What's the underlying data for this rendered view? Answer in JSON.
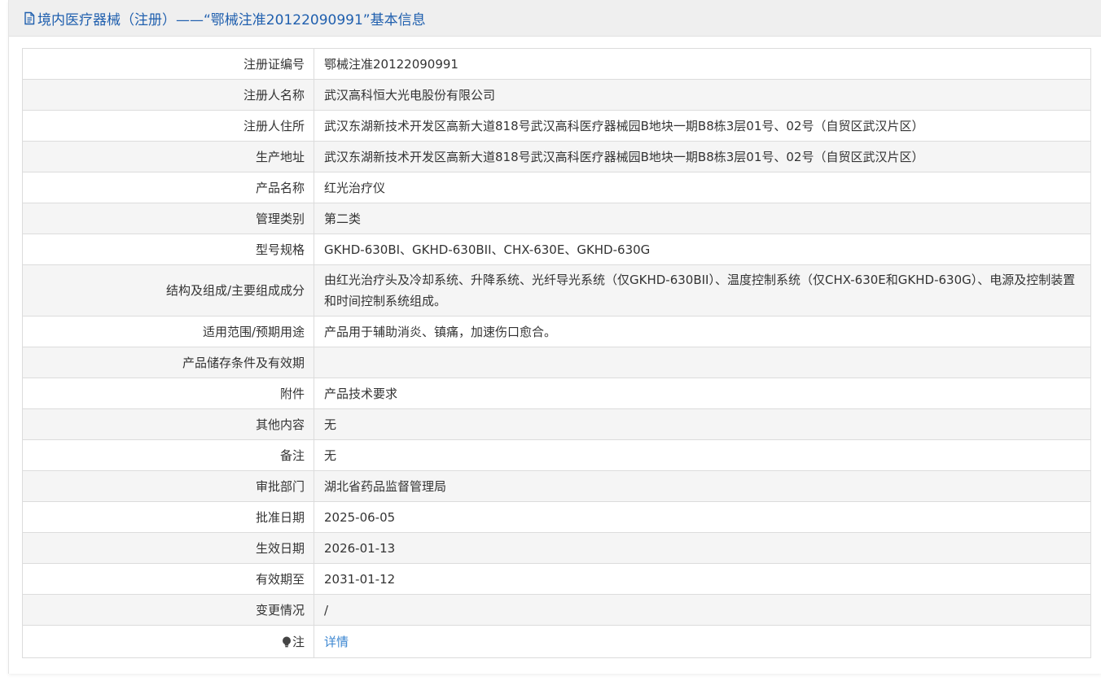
{
  "header": {
    "title": "境内医疗器械（注册）——“鄂械注准20122090991”基本信息"
  },
  "rows": [
    {
      "label": "注册证编号",
      "value": "鄂械注准20122090991"
    },
    {
      "label": "注册人名称",
      "value": "武汉高科恒大光电股份有限公司"
    },
    {
      "label": "注册人住所",
      "value": "武汉东湖新技术开发区高新大道818号武汉高科医疗器械园B地块一期B8栋3层01号、02号（自贸区武汉片区）"
    },
    {
      "label": "生产地址",
      "value": "武汉东湖新技术开发区高新大道818号武汉高科医疗器械园B地块一期B8栋3层01号、02号（自贸区武汉片区）"
    },
    {
      "label": "产品名称",
      "value": "红光治疗仪"
    },
    {
      "label": "管理类别",
      "value": "第二类"
    },
    {
      "label": "型号规格",
      "value": "GKHD-630BI、GKHD-630BII、CHX-630E、GKHD-630G"
    },
    {
      "label": "结构及组成/主要组成成分",
      "value": "由红光治疗头及冷却系统、升降系统、光纤导光系统（仅GKHD-630BII）、温度控制系统（仅CHX-630E和GKHD-630G）、电源及控制装置和时间控制系统组成。"
    },
    {
      "label": "适用范围/预期用途",
      "value": "产品用于辅助消炎、镇痛，加速伤口愈合。"
    },
    {
      "label": "产品储存条件及有效期",
      "value": ""
    },
    {
      "label": "附件",
      "value": "产品技术要求"
    },
    {
      "label": "其他内容",
      "value": "无"
    },
    {
      "label": "备注",
      "value": "无"
    },
    {
      "label": "审批部门",
      "value": "湖北省药品监督管理局"
    },
    {
      "label": "批准日期",
      "value": "2025-06-05"
    },
    {
      "label": "生效日期",
      "value": "2026-01-13"
    },
    {
      "label": "有效期至",
      "value": "2031-01-12"
    },
    {
      "label": "变更情况",
      "value": "/"
    }
  ],
  "note_row": {
    "label": "注",
    "link_text": "详情",
    "icon": "lightbulb-icon"
  },
  "colors": {
    "header_text": "#1f5fae",
    "link": "#3b86d1",
    "stripe": "#f5f5f5",
    "border": "#dcdcdc"
  }
}
